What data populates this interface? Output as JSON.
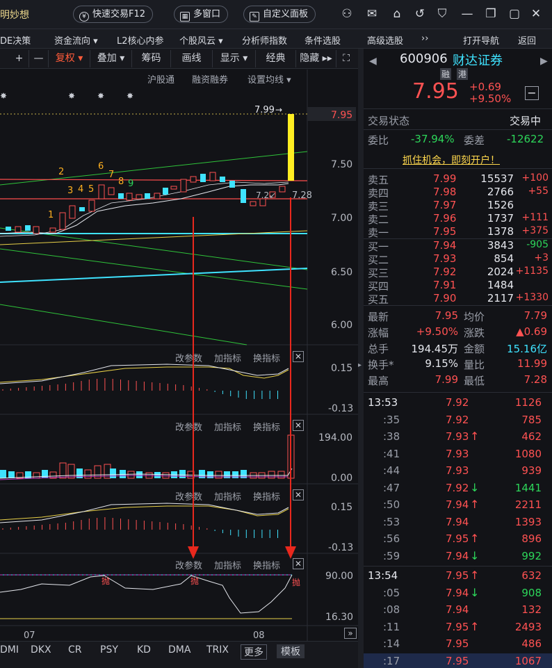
{
  "top": {
    "brand": "明妙想",
    "quick_trade": "快速交易F12",
    "multi_window": "多窗口",
    "custom_panel": "自定义面板"
  },
  "menu": [
    "DE决策",
    "资金流向 ▾",
    "L2核心内参",
    "个股风云 ▾",
    "分析师指数",
    "条件选股",
    "高级选股",
    "››",
    "打开导航",
    "返回"
  ],
  "toolbar": [
    "+",
    "—",
    "复权 ▾",
    "叠加 ▾",
    "筹码",
    "画线",
    "显示 ▾",
    "经典",
    "隐藏 ▸▸"
  ],
  "subbar": {
    "hgt": "沪股通",
    "margin": "融资融券",
    "ma": "设置均线 ▾"
  },
  "price_axis": [
    "7.95",
    "7.50",
    "7.00",
    "6.50",
    "6.00"
  ],
  "annotations": {
    "high": "7.99",
    "low": "7.28",
    "nums": [
      "1",
      "2",
      "3",
      "4",
      "5",
      "6",
      "7",
      "8",
      "9"
    ]
  },
  "panels": [
    {
      "ctrls": [
        "改参数",
        "加指标",
        "换指标"
      ],
      "ticks": [
        "0.15",
        "-0.13"
      ]
    },
    {
      "ctrls": [
        "改参数",
        "加指标",
        "换指标"
      ],
      "ticks": [
        "194.00",
        "0.00"
      ]
    },
    {
      "ctrls": [
        "改参数",
        "加指标",
        "换指标"
      ],
      "ticks": [
        "0.15",
        "-0.13"
      ]
    },
    {
      "ctrls": [
        "改参数",
        "加指标",
        "换指标"
      ],
      "ticks": [
        "90.00",
        "16.30"
      ],
      "marks": [
        "抛",
        "抛",
        "抛"
      ]
    }
  ],
  "dates": [
    "07",
    "08"
  ],
  "bottom_tabs": [
    "DMI",
    "DKX",
    "CR",
    "PSY",
    "KD",
    "DMA",
    "TRIX",
    "更多",
    "模板"
  ],
  "stock": {
    "code": "600906",
    "name": "财达证券",
    "tag1": "融",
    "tag2": "港",
    "price": "7.95",
    "chg": "+0.69",
    "pct": "+9.50%"
  },
  "status": {
    "label": "交易状态",
    "value": "交易中"
  },
  "ratio": {
    "wb_label": "委比",
    "wb": "-37.94%",
    "wc_label": "委差",
    "wc": "-12622"
  },
  "promo": "抓住机会，即刻开户！",
  "asks": [
    {
      "l": "卖五",
      "p": "7.99",
      "v": "15537",
      "d": "+100"
    },
    {
      "l": "卖四",
      "p": "7.98",
      "v": "2766",
      "d": "+55"
    },
    {
      "l": "卖三",
      "p": "7.97",
      "v": "1526",
      "d": ""
    },
    {
      "l": "卖二",
      "p": "7.96",
      "v": "1737",
      "d": "+111"
    },
    {
      "l": "卖一",
      "p": "7.95",
      "v": "1378",
      "d": "+375"
    }
  ],
  "bids": [
    {
      "l": "买一",
      "p": "7.94",
      "v": "3843",
      "d": "-905"
    },
    {
      "l": "买二",
      "p": "7.93",
      "v": "854",
      "d": "+3"
    },
    {
      "l": "买三",
      "p": "7.92",
      "v": "2024",
      "d": "+1135"
    },
    {
      "l": "买四",
      "p": "7.91",
      "v": "1484",
      "d": ""
    },
    {
      "l": "买五",
      "p": "7.90",
      "v": "2117",
      "d": "+1330"
    }
  ],
  "stats": [
    [
      "最新",
      "7.95",
      "均价",
      "7.79"
    ],
    [
      "涨幅",
      "+9.50%",
      "涨跌",
      "▲0.69"
    ],
    [
      "总手",
      "194.45万",
      "金额",
      "15.16亿"
    ],
    [
      "换手*",
      "9.15%",
      "量比",
      "11.99"
    ],
    [
      "最高",
      "7.99",
      "最低",
      "7.28"
    ]
  ],
  "ticks": [
    {
      "t": "13:53",
      "p": "7.92",
      "a": "",
      "v": "1126",
      "c": "red"
    },
    {
      "t": ":35",
      "p": "7.92",
      "a": "",
      "v": "785",
      "c": "red"
    },
    {
      "t": ":38",
      "p": "7.93",
      "a": "↑",
      "v": "462",
      "c": "red"
    },
    {
      "t": ":41",
      "p": "7.93",
      "a": "",
      "v": "1080",
      "c": "red"
    },
    {
      "t": ":44",
      "p": "7.93",
      "a": "",
      "v": "939",
      "c": "red"
    },
    {
      "t": ":47",
      "p": "7.92",
      "a": "↓",
      "v": "1441",
      "c": "grn"
    },
    {
      "t": ":50",
      "p": "7.94",
      "a": "↑",
      "v": "2211",
      "c": "red"
    },
    {
      "t": ":53",
      "p": "7.94",
      "a": "",
      "v": "1393",
      "c": "red"
    },
    {
      "t": ":56",
      "p": "7.95",
      "a": "↑",
      "v": "896",
      "c": "red"
    },
    {
      "t": ":59",
      "p": "7.94",
      "a": "↓",
      "v": "992",
      "c": "grn"
    },
    {
      "t": "13:54",
      "p": "7.95",
      "a": "↑",
      "v": "632",
      "c": "red"
    },
    {
      "t": ":05",
      "p": "7.94",
      "a": "↓",
      "v": "908",
      "c": "grn"
    },
    {
      "t": ":08",
      "p": "7.94",
      "a": "",
      "v": "132",
      "c": "red"
    },
    {
      "t": ":11",
      "p": "7.95",
      "a": "↑",
      "v": "2493",
      "c": "red"
    },
    {
      "t": ":14",
      "p": "7.95",
      "a": "",
      "v": "486",
      "c": "red"
    },
    {
      "t": ":17",
      "p": "7.95",
      "a": "",
      "v": "1067",
      "c": "red"
    }
  ]
}
